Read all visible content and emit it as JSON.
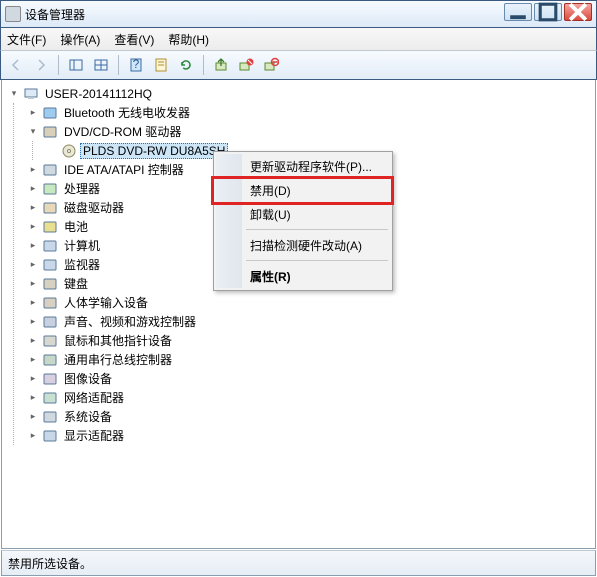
{
  "window": {
    "title": "设备管理器"
  },
  "menubar": {
    "file": "文件(F)",
    "action": "操作(A)",
    "view": "查看(V)",
    "help": "帮助(H)"
  },
  "tree": {
    "root": "USER-20141112HQ",
    "nodes": [
      {
        "label": "Bluetooth 无线电收发器",
        "expanded": false
      },
      {
        "label": "DVD/CD-ROM 驱动器",
        "expanded": true,
        "children": [
          {
            "label": "PLDS DVD-RW DU8A5SH",
            "selected": true
          }
        ]
      },
      {
        "label": "IDE ATA/ATAPI 控制器",
        "expanded": false
      },
      {
        "label": "处理器",
        "expanded": false
      },
      {
        "label": "磁盘驱动器",
        "expanded": false
      },
      {
        "label": "电池",
        "expanded": false
      },
      {
        "label": "计算机",
        "expanded": false
      },
      {
        "label": "监视器",
        "expanded": false
      },
      {
        "label": "键盘",
        "expanded": false
      },
      {
        "label": "人体学输入设备",
        "expanded": false
      },
      {
        "label": "声音、视频和游戏控制器",
        "expanded": false
      },
      {
        "label": "鼠标和其他指针设备",
        "expanded": false
      },
      {
        "label": "通用串行总线控制器",
        "expanded": false
      },
      {
        "label": "图像设备",
        "expanded": false
      },
      {
        "label": "网络适配器",
        "expanded": false
      },
      {
        "label": "系统设备",
        "expanded": false
      },
      {
        "label": "显示适配器",
        "expanded": false
      }
    ]
  },
  "context_menu": {
    "update": "更新驱动程序软件(P)...",
    "disable": "禁用(D)",
    "uninstall": "卸载(U)",
    "scan": "扫描检测硬件改动(A)",
    "properties": "属性(R)"
  },
  "statusbar": {
    "text": "禁用所选设备。"
  }
}
